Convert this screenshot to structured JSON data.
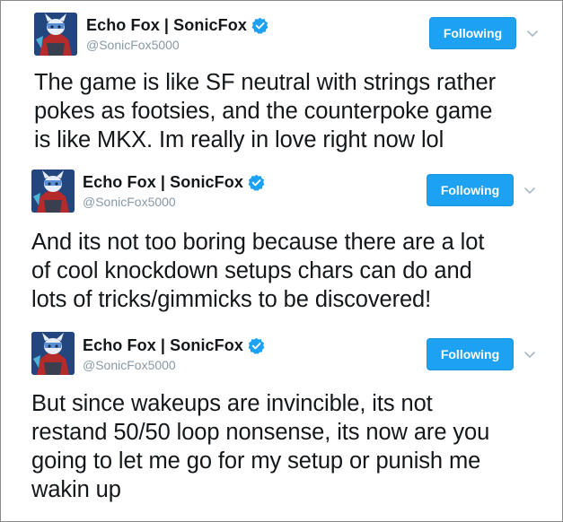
{
  "tweets": [
    {
      "display_name": "Echo Fox | SonicFox",
      "handle": "@SonicFox5000",
      "follow_label": "Following",
      "text_lines": [
        "The game is like SF neutral with strings rather",
        "pokes as footsies, and the counterpoke game",
        "is like MKX. Im really in love right now lol"
      ]
    },
    {
      "display_name": "Echo Fox | SonicFox",
      "handle": "@SonicFox5000",
      "follow_label": "Following",
      "text_lines": [
        "And its not too boring because there are a lot",
        "of cool knockdown setups chars can do and",
        "lots of tricks/gimmicks to be discovered!"
      ]
    },
    {
      "display_name": "Echo Fox | SonicFox",
      "handle": "@SonicFox5000",
      "follow_label": "Following",
      "text_lines": [
        "But since wakeups are invincible, its not",
        "restand 50/50 loop nonsense, its now are you",
        "going to let me go for my setup or punish me",
        "wakin up"
      ]
    }
  ],
  "icons": {
    "avatar": "avatar-image",
    "verified": "verified-badge-icon",
    "caret": "chevron-down-icon"
  },
  "colors": {
    "follow_button": "#1da1f2",
    "verified": "#1da1f2",
    "handle": "#8899a6",
    "text": "#14171a"
  }
}
